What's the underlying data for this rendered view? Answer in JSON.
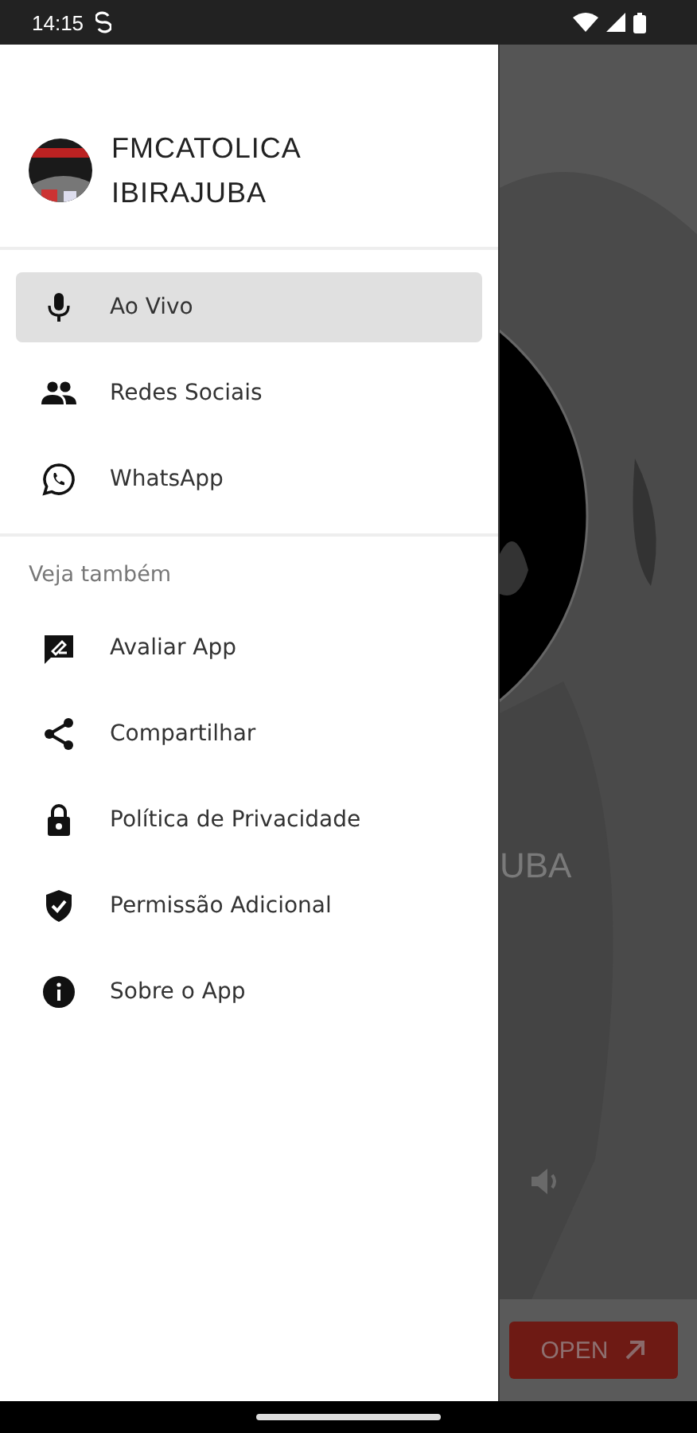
{
  "status_bar": {
    "time": "14:15"
  },
  "drawer": {
    "title_lines": [
      "FMCATOLICA",
      "IBIRAJUBA"
    ],
    "items": [
      {
        "kind": "mic",
        "label": "Ao Vivo",
        "selected": true
      },
      {
        "kind": "people",
        "label": "Redes Sociais",
        "selected": false
      },
      {
        "kind": "whatsapp",
        "label": "WhatsApp",
        "selected": false
      }
    ],
    "section": {
      "title": "Veja também",
      "items": [
        {
          "kind": "rate",
          "label": "Avaliar App",
          "selected": false
        },
        {
          "kind": "share",
          "label": "Compartilhar",
          "selected": false
        },
        {
          "kind": "lock",
          "label": "Política de Privacidade",
          "selected": false
        },
        {
          "kind": "shield",
          "label": "Permissão Adicional",
          "selected": false
        },
        {
          "kind": "info",
          "label": "Sobre o App",
          "selected": false
        }
      ]
    }
  },
  "background": {
    "station_fragment": "UBA",
    "ad_button": "OPEN"
  }
}
